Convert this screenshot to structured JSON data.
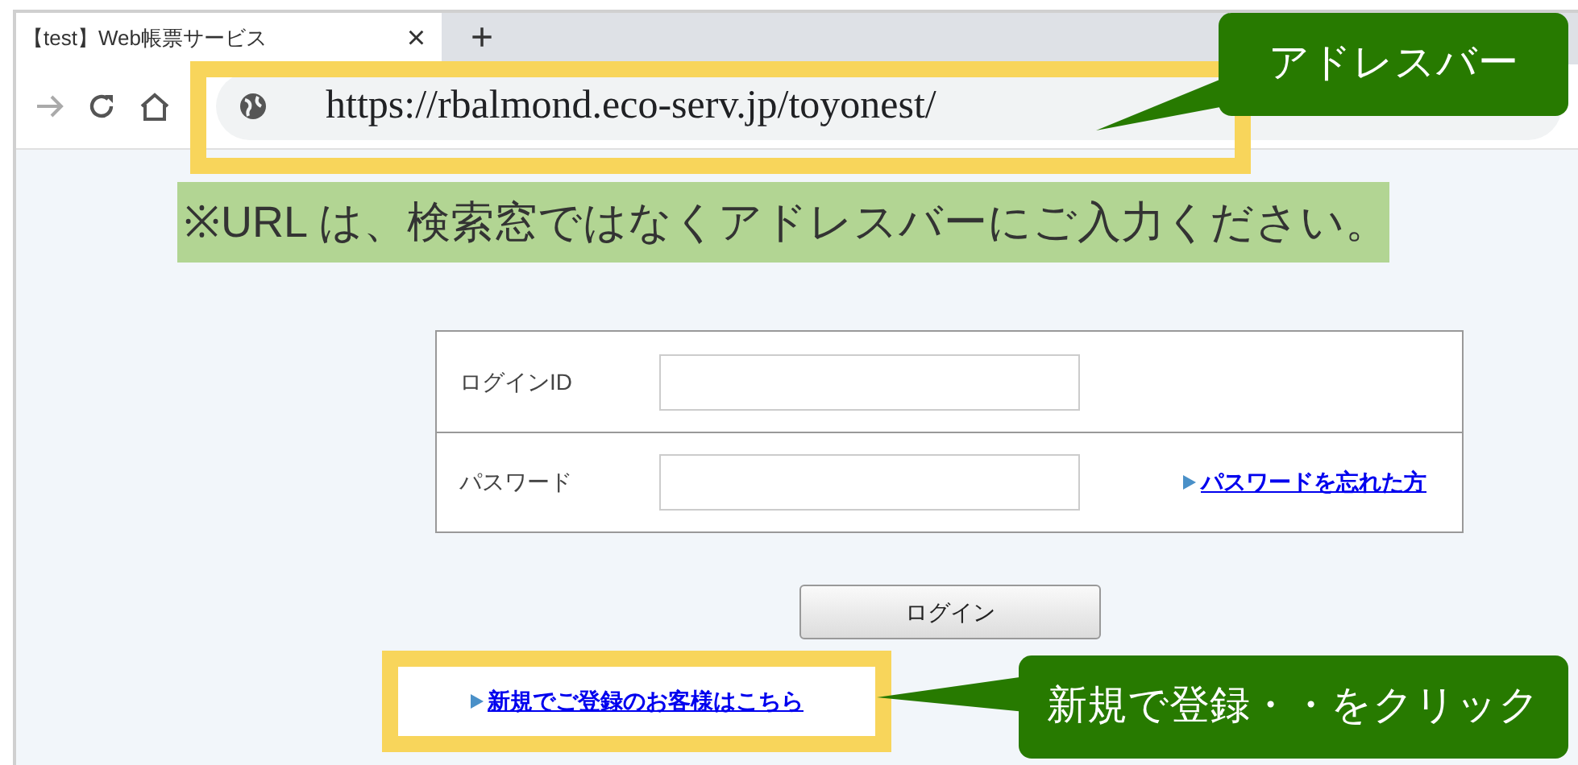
{
  "browser": {
    "tab": {
      "title": "【test】Web帳票サービス",
      "close": "×"
    },
    "new_tab": "+",
    "address": "https://rbalmond.eco-serv.jp/toyonest/"
  },
  "page": {
    "fields": [
      {
        "label": "ログインID"
      },
      {
        "label": "パスワード",
        "link": "パスワードを忘れた方"
      }
    ],
    "login_button": "ログイン",
    "signup_link": "新規でご登録のお客様はこちら"
  },
  "annotations": {
    "address_callout": "アドレスバー",
    "note": "※URL は、検索窓ではなくアドレスバーにご入力ください。",
    "signup_callout": "新規で登録・・をクリック"
  }
}
